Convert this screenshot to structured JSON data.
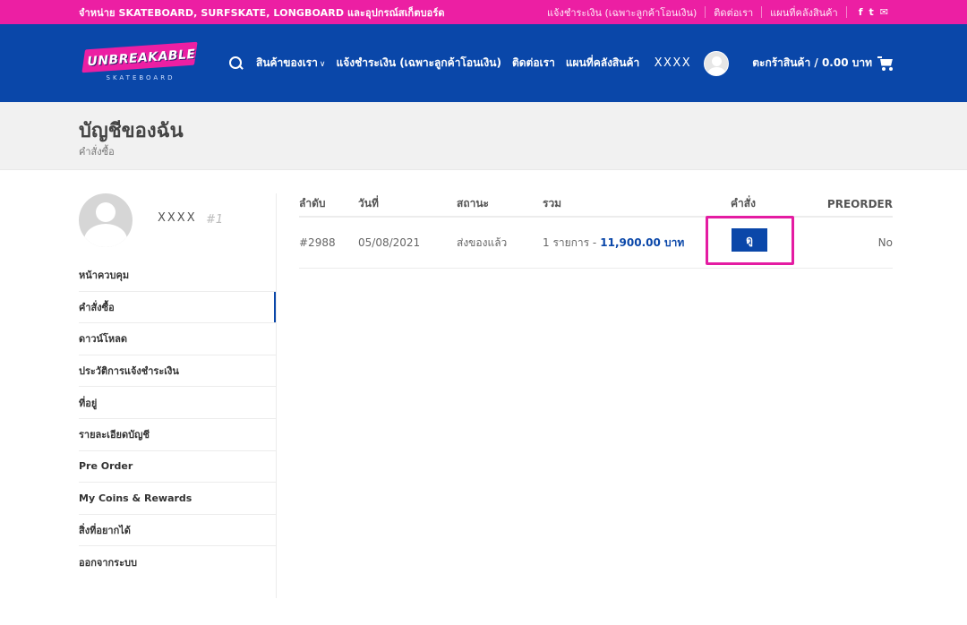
{
  "topbar": {
    "promo": "จำหน่าย SKATEBOARD, SURFSKATE, LONGBOARD และอุปกรณ์สเก็ตบอร์ด",
    "links": [
      "แจ้งชำระเงิน (เฉพาะลูกค้าโอนเงิน)",
      "ติดต่อเรา",
      "แผนที่คลังสินค้า"
    ],
    "social": {
      "facebook": "f",
      "twitter": "t",
      "mail": "✉"
    }
  },
  "logo": {
    "word": "UNBREAKABLE",
    "sub": "SKATEBOARD"
  },
  "nav": {
    "items": [
      "สินค้าของเรา",
      "แจ้งชำระเงิน (เฉพาะลูกค้าโอนเงิน)",
      "ติดต่อเรา",
      "แผนที่คลังสินค้า"
    ],
    "chevron": "∨"
  },
  "header_right": {
    "user": "XXXX",
    "cart": "ตะกร้าสินค้า / 0.00 บาท"
  },
  "page": {
    "title": "บัญชีของฉัน",
    "breadcrumb": "คำสั่งซื้อ"
  },
  "sidebar": {
    "username": "XXXX",
    "user_id": "#1",
    "menu": [
      "หน้าควบคุม",
      "คำสั่งซื้อ",
      "ดาวน์โหลด",
      "ประวัติการแจ้งชำระเงิน",
      "ที่อยู่",
      "รายละเอียดบัญชี",
      "Pre Order",
      "My Coins & Rewards",
      "สิ่งที่อยากได้",
      "ออกจากระบบ"
    ]
  },
  "orders": {
    "headers": [
      "ลำดับ",
      "วันที่",
      "สถานะ",
      "รวม",
      "คำสั่ง",
      "PREORDER"
    ],
    "rows": [
      {
        "number": "#2988",
        "date": "05/08/2021",
        "status": "ส่งของแล้ว",
        "items": "1 รายการ -",
        "total": "11,900.00 บาท",
        "action": "ดู",
        "preorder": "No"
      }
    ]
  },
  "colors": {
    "pink": "#ec1fa3",
    "blue": "#0a47a9",
    "highlight": "#e41ca2"
  }
}
